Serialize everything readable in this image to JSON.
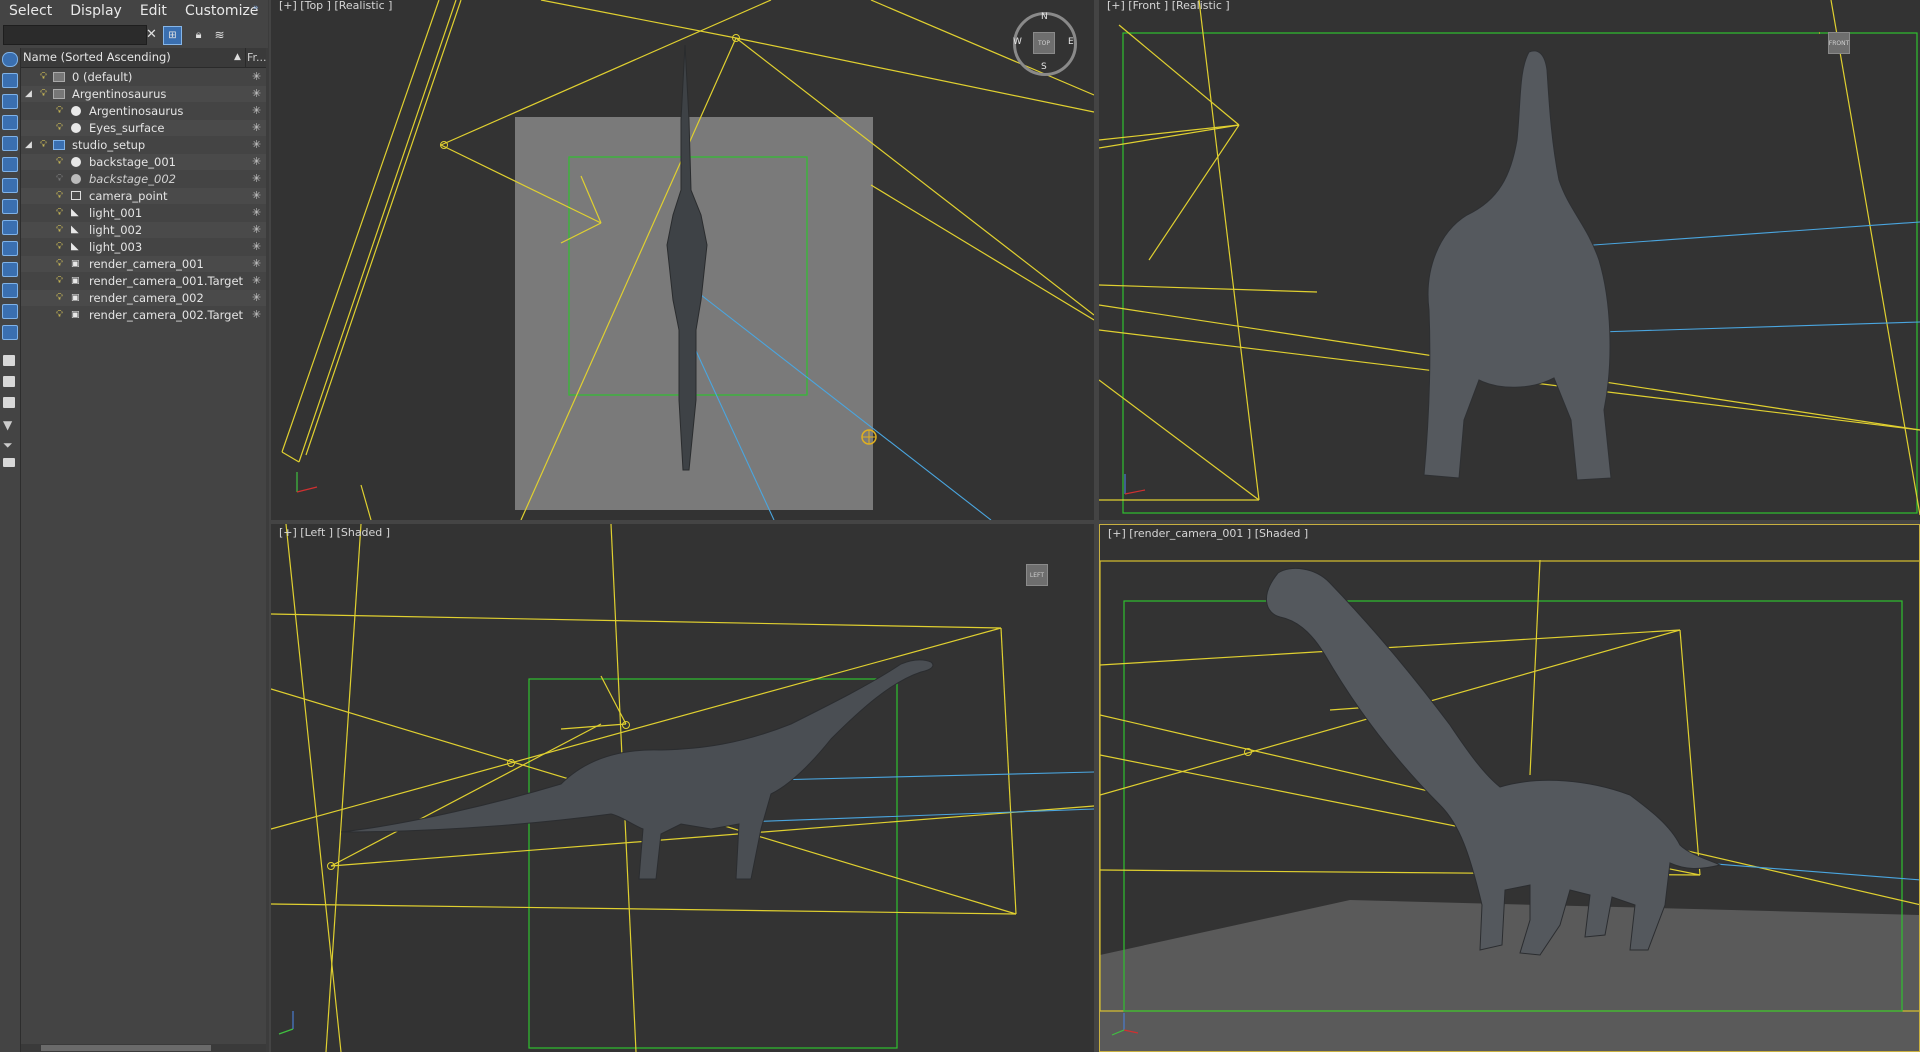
{
  "menu": {
    "items": [
      "Select",
      "Display",
      "Edit",
      "Customize"
    ]
  },
  "explorer": {
    "search_value": "",
    "column_name": "Name (Sorted Ascending)",
    "column_frozen": "Fr...",
    "rows": [
      {
        "label": "0 (default)",
        "kind": "layer"
      },
      {
        "label": "Argentinosaurus",
        "kind": "layer"
      },
      {
        "label": "Argentinosaurus",
        "kind": "object"
      },
      {
        "label": "Eyes_surface",
        "kind": "object"
      },
      {
        "label": "studio_setup",
        "kind": "layer"
      },
      {
        "label": "backstage_001",
        "kind": "object"
      },
      {
        "label": "backstage_002",
        "kind": "object"
      },
      {
        "label": "camera_point",
        "kind": "helper"
      },
      {
        "label": "light_001",
        "kind": "light"
      },
      {
        "label": "light_002",
        "kind": "light"
      },
      {
        "label": "light_003",
        "kind": "light"
      },
      {
        "label": "render_camera_001",
        "kind": "camera"
      },
      {
        "label": "render_camera_001.Target",
        "kind": "camera"
      },
      {
        "label": "render_camera_002",
        "kind": "camera"
      },
      {
        "label": "render_camera_002.Target",
        "kind": "camera"
      }
    ]
  },
  "viewports": {
    "top": {
      "label": "[+] [Top ] [Realistic ]",
      "cube": "TOP",
      "compass": {
        "n": "N",
        "s": "S",
        "e": "E",
        "w": "W"
      }
    },
    "front": {
      "label": "[+] [Front ] [Realistic ]",
      "cube": "FRONT"
    },
    "left": {
      "label": "[+] [Left ] [Shaded ]",
      "cube": "LEFT"
    },
    "camera": {
      "label": "[+] [render_camera_001 ] [Shaded ]"
    }
  },
  "colors": {
    "accent_bulb": "#e9d45a",
    "camera_lines": "#e0d030",
    "light_target": "#4aa6e0",
    "bounds": "#30c030",
    "creature": "#5a5e63"
  },
  "icons": {
    "clear": "close-icon",
    "filter": "filter-icon",
    "lock": "lock-icon",
    "layers": "layers-icon",
    "visible": "bulb-icon",
    "frozen": "snowflake-icon"
  }
}
